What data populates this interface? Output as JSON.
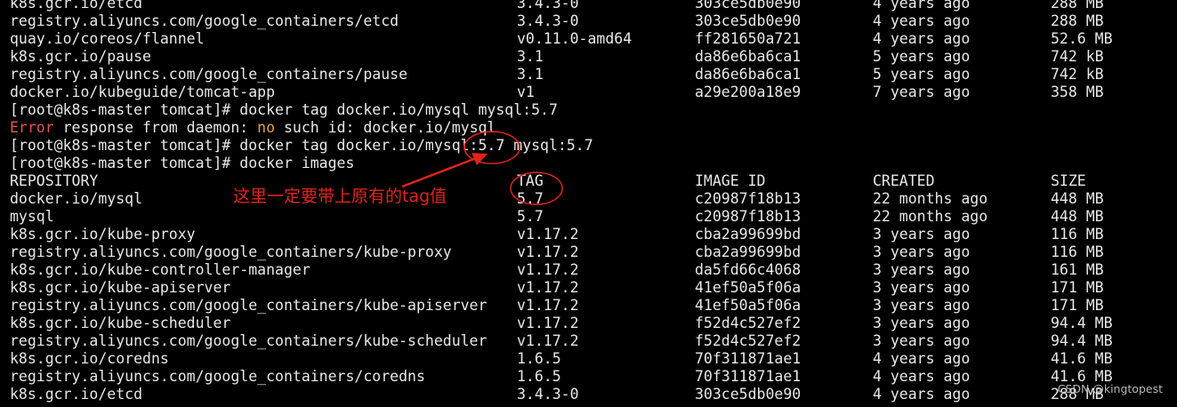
{
  "top_rows": [
    [
      "k8s.gcr.io/etcd",
      "3.4.3-0",
      "303ce5db0e90",
      "4 years ago",
      "288 MB"
    ],
    [
      "registry.aliyuncs.com/google_containers/etcd",
      "3.4.3-0",
      "303ce5db0e90",
      "4 years ago",
      "288 MB"
    ],
    [
      "quay.io/coreos/flannel",
      "v0.11.0-amd64",
      "ff281650a721",
      "4 years ago",
      "52.6 MB"
    ],
    [
      "k8s.gcr.io/pause",
      "3.1",
      "da86e6ba6ca1",
      "5 years ago",
      "742 kB"
    ],
    [
      "registry.aliyuncs.com/google_containers/pause",
      "3.1",
      "da86e6ba6ca1",
      "5 years ago",
      "742 kB"
    ],
    [
      "docker.io/kubeguide/tomcat-app",
      "v1",
      "a29e200a18e9",
      "7 years ago",
      "358 MB"
    ]
  ],
  "commands": {
    "cmd1": "[root@k8s-master tomcat]# docker tag docker.io/mysql mysql:5.7",
    "error_word": "Error",
    "error_mid": " response from daemon: ",
    "error_no": "no",
    "error_tail": " such id: docker.io/mysql",
    "cmd2": "[root@k8s-master tomcat]# docker tag docker.io/mysql:5.7 mysql:5.7",
    "cmd3": "[root@k8s-master tomcat]# docker images"
  },
  "header": [
    "REPOSITORY",
    "TAG",
    "IMAGE ID",
    "CREATED",
    "SIZE"
  ],
  "rows": [
    [
      "docker.io/mysql",
      "5.7",
      "c20987f18b13",
      "22 months ago",
      "448 MB"
    ],
    [
      "mysql",
      "5.7",
      "c20987f18b13",
      "22 months ago",
      "448 MB"
    ],
    [
      "k8s.gcr.io/kube-proxy",
      "v1.17.2",
      "cba2a99699bd",
      "3 years ago",
      "116 MB"
    ],
    [
      "registry.aliyuncs.com/google_containers/kube-proxy",
      "v1.17.2",
      "cba2a99699bd",
      "3 years ago",
      "116 MB"
    ],
    [
      "k8s.gcr.io/kube-controller-manager",
      "v1.17.2",
      "da5fd66c4068",
      "3 years ago",
      "161 MB"
    ],
    [
      "k8s.gcr.io/kube-apiserver",
      "v1.17.2",
      "41ef50a5f06a",
      "3 years ago",
      "171 MB"
    ],
    [
      "registry.aliyuncs.com/google_containers/kube-apiserver",
      "v1.17.2",
      "41ef50a5f06a",
      "3 years ago",
      "171 MB"
    ],
    [
      "k8s.gcr.io/kube-scheduler",
      "v1.17.2",
      "f52d4c527ef2",
      "3 years ago",
      "94.4 MB"
    ],
    [
      "registry.aliyuncs.com/google_containers/kube-scheduler",
      "v1.17.2",
      "f52d4c527ef2",
      "3 years ago",
      "94.4 MB"
    ],
    [
      "k8s.gcr.io/coredns",
      "1.6.5",
      "70f311871ae1",
      "4 years ago",
      "41.6 MB"
    ],
    [
      "registry.aliyuncs.com/google_containers/coredns",
      "1.6.5",
      "70f311871ae1",
      "4 years ago",
      "41.6 MB"
    ],
    [
      "k8s.gcr.io/etcd",
      "3.4.3-0",
      "303ce5db0e90",
      "4 years ago",
      "288 MB"
    ]
  ],
  "annotation": {
    "note": "这里一定要带上原有的tag值",
    "color": "#e0241c"
  },
  "watermark": "CSDN @kingtopest",
  "colors": {
    "background": "#000000",
    "text": "#e8e8e8",
    "error": "#e05a4a",
    "keyword_no": "#e0a14a"
  }
}
